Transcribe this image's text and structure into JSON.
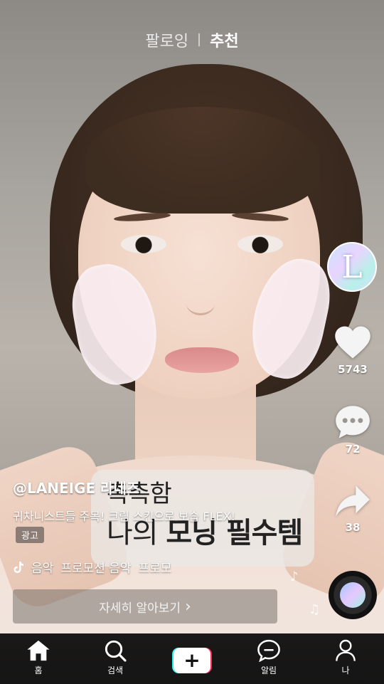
{
  "top_tabs": {
    "following": "팔로잉",
    "recommended": "추천"
  },
  "video": {
    "caption_line1": "촉촉함",
    "caption_line2_plain": "나의",
    "caption_line2_bold": "모닝 필수템"
  },
  "post": {
    "username": "@LANEIGE 라네즈",
    "description": "귀차니스트들 주목! 크림 스킨으로 보습 FLEX!",
    "ad_badge": "광고",
    "music": {
      "items": [
        "음악",
        "프로모션 음악",
        "프로모"
      ]
    },
    "cta_label": "자세히 알아보기",
    "cta_chevron": "›"
  },
  "rail": {
    "avatar_letter": "L",
    "likes": "5743",
    "comments": "72",
    "shares": "38"
  },
  "nav": {
    "home": "홈",
    "search": "검색",
    "create": "+",
    "inbox": "알림",
    "profile": "나"
  },
  "colors": {
    "accent_cyan": "#25f4ee",
    "accent_red": "#fe2c55"
  }
}
